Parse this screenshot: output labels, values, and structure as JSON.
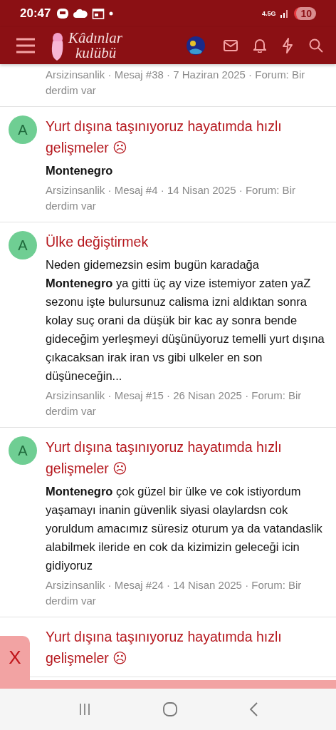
{
  "status_bar": {
    "time": "20:47",
    "network": "4.5G",
    "battery": "10"
  },
  "header": {
    "logo_line_1": "Kâdınlar",
    "logo_line_2": "kulübü"
  },
  "results": [
    {
      "meta": "Arsizinsanlik · Mesaj #38 · 7 Haziran 2025 · Forum: Bir derdim var",
      "partial": true
    },
    {
      "avatar": "A",
      "title": "Yurt dışına taşınıyoruz hayatımda hızlı gelişmeler ☹",
      "snippet": "Montenegro",
      "snippet_bold": true,
      "meta": "Arsizinsanlik · Mesaj #4 · 14 Nisan 2025 · Forum: Bir derdim var"
    },
    {
      "avatar": "A",
      "title": "Ülke değiştirmek",
      "snippet": "Neden gidemezsin esim bugün karadağa **Montenegro** ya gitti üç ay vize istemiyor zaten yaZ sezonu işte bulursunuz calisma izni aldıktan sonra kolay suç orani da düşük bir kac ay sonra bende gideceğim yerleşmeyi düşünüyoruz temelli yurt dışına çıkacaksan irak iran vs gibi ulkeler en son düşüneceğin...",
      "snippet_bold": false,
      "meta": "Arsizinsanlik · Mesaj #15 · 26 Nisan 2025 · Forum: Bir derdim var"
    },
    {
      "avatar": "A",
      "title": "Yurt dışına taşınıyoruz hayatımda hızlı gelişmeler ☹",
      "snippet": "**Montenegro** çok güzel bir ülke ve cok istiyordum yaşamayı inanin güvenlik siyasi olaylardsn cok yoruldum amacımız süresiz oturum ya da vatandaslik alabilmek ileride en cok da kizimizin geleceği icin gidiyoruz",
      "snippet_bold": false,
      "meta": "Arsizinsanlik · Mesaj #24 · 14 Nisan 2025 · Forum: Bir derdim var"
    },
    {
      "title": "Yurt dışına taşınıyoruz hayatımda hızlı gelişmeler ☹"
    }
  ],
  "ad_banner": {
    "close_label": "X"
  }
}
